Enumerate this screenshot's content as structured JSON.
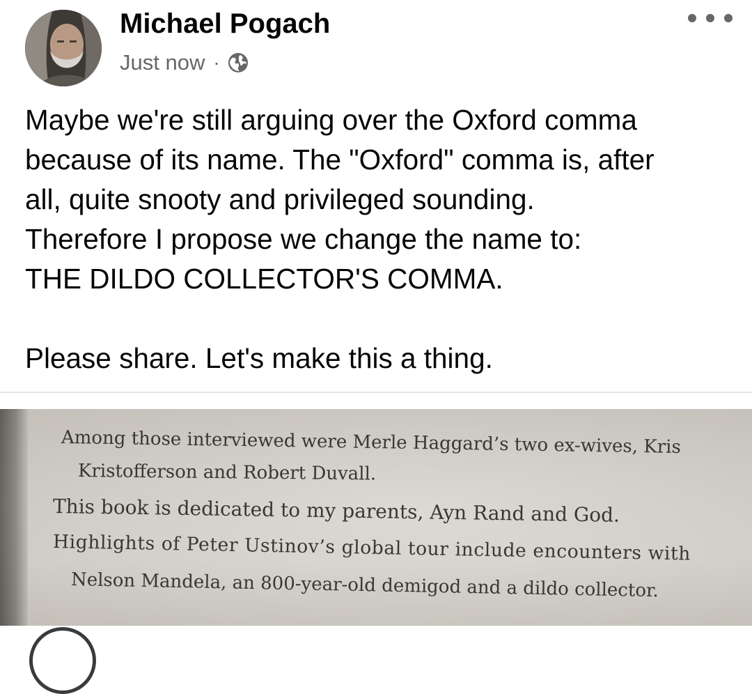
{
  "post": {
    "author": "Michael Pogach",
    "timestamp": "Just now",
    "separator": "·",
    "audience_icon": "globe-icon",
    "more_icon": "more-horizontal-icon",
    "text_lines": [
      "Maybe we're still arguing over the Oxford comma",
      "because of its name. The \"Oxford\" comma is, after",
      "all, quite snooty and privileged sounding.",
      "Therefore I propose we change the name to:",
      "THE DILDO COLLECTOR'S COMMA."
    ],
    "text_closing": "Please share. Let's make this a thing."
  },
  "photo": {
    "lines": [
      "Among those interviewed were Merle Haggard’s two ex-wives, Kris",
      "Kristofferson and Robert Duvall.",
      "This book is dedicated to my parents, Ayn Rand and God.",
      "Highlights of Peter Ustinov’s global tour include encounters with",
      "Nelson Mandela, an 800-year-old demigod and a dildo collector."
    ]
  },
  "colors": {
    "name_text": "#050505",
    "meta_text": "#65676b",
    "book_text": "#3a3631",
    "page_bg": "#ffffff"
  }
}
